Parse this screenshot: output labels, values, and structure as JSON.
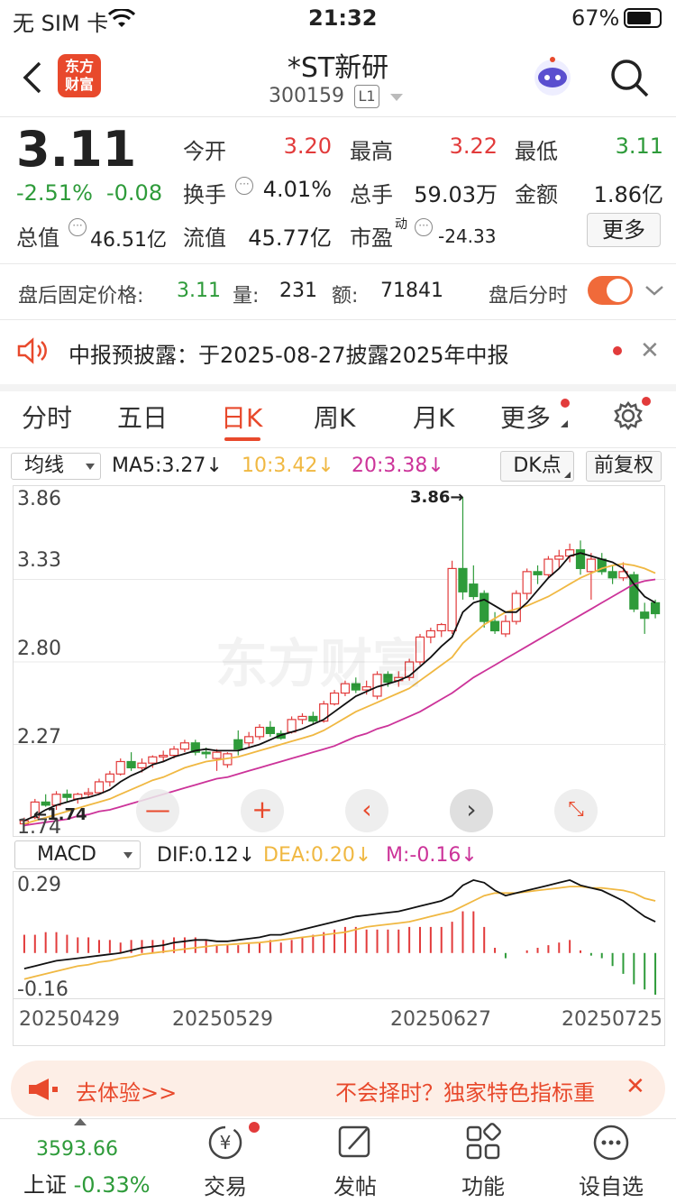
{
  "status": {
    "carrier": "无 SIM 卡",
    "time": "21:32",
    "battery": "67%"
  },
  "header": {
    "logo": "东方\n财富",
    "title": "*ST新研",
    "code": "300159",
    "level": "L1"
  },
  "quote": {
    "price": "3.11",
    "pct": "-2.51%",
    "chg": "-0.08",
    "open_label": "今开",
    "open": "3.20",
    "high_label": "最高",
    "high": "3.22",
    "low_label": "最低",
    "low": "3.11",
    "turnover_label": "换手",
    "turnover": "4.01%",
    "vol_label": "总手",
    "vol": "59.03万",
    "amount_label": "金额",
    "amount": "1.86亿",
    "mktcap_label": "总值",
    "mktcap": "46.51亿",
    "float_label": "流值",
    "float": "45.77亿",
    "pe_label": "市盈",
    "pe_sup": "动",
    "pe": "-24.33",
    "more": "更多"
  },
  "after": {
    "label": "盘后固定价格:",
    "price": "3.11",
    "vol_label": "量:",
    "vol": "231",
    "amt_label": "额:",
    "amt": "71841",
    "toggle_label": "盘后分时"
  },
  "notice": {
    "text": "中报预披露：于2025-08-27披露2025年中报"
  },
  "tabs": [
    "分时",
    "五日",
    "日K",
    "周K",
    "月K",
    "更多"
  ],
  "ma": {
    "type": "均线",
    "ma5": "MA5:3.27",
    "ma10": "10:3.42",
    "ma20": "20:3.38",
    "dk": "DK点",
    "adj": "前复权"
  },
  "kline": {
    "yticks": [
      "3.86",
      "3.33",
      "2.80",
      "2.27",
      "1.74"
    ],
    "max_label": "3.86",
    "min_label": "1.74",
    "watermark": "东方财富"
  },
  "macd": {
    "type": "MACD",
    "dif": "DIF:0.12",
    "dea": "DEA:0.20",
    "m": "M:-0.16",
    "ytop": "0.29",
    "ybot": "-0.16"
  },
  "dates": [
    "20250429",
    "20250529",
    "20250627",
    "20250725"
  ],
  "promo": {
    "left": "去体验>>",
    "right": "不会择时？独家特色指标重"
  },
  "bottom": {
    "index_val": "3593.66",
    "index_name": "上证",
    "index_pct": "-0.33%",
    "trade": "交易",
    "post": "发帖",
    "func": "功能",
    "settings": "设自选"
  },
  "colors": {
    "up": "#e23b3b",
    "down": "#2e9b3a",
    "ma10": "#f0b842",
    "ma20": "#cc3399"
  },
  "chart_data": {
    "type": "candlestick",
    "ylim": [
      1.74,
      3.86
    ],
    "candles": [
      [
        1.76,
        1.8,
        1.74,
        1.78
      ],
      [
        1.8,
        1.92,
        1.79,
        1.9
      ],
      [
        1.9,
        1.95,
        1.87,
        1.88
      ],
      [
        1.88,
        1.97,
        1.85,
        1.95
      ],
      [
        1.95,
        1.98,
        1.9,
        1.93
      ],
      [
        1.92,
        1.96,
        1.89,
        1.95
      ],
      [
        1.95,
        1.99,
        1.93,
        1.96
      ],
      [
        1.96,
        2.05,
        1.95,
        2.03
      ],
      [
        2.03,
        2.1,
        2.0,
        2.08
      ],
      [
        2.08,
        2.18,
        2.07,
        2.16
      ],
      [
        2.16,
        2.22,
        2.1,
        2.12
      ],
      [
        2.12,
        2.18,
        2.09,
        2.15
      ],
      [
        2.15,
        2.2,
        2.12,
        2.19
      ],
      [
        2.19,
        2.23,
        2.16,
        2.2
      ],
      [
        2.2,
        2.26,
        2.18,
        2.24
      ],
      [
        2.24,
        2.3,
        2.22,
        2.28
      ],
      [
        2.28,
        2.3,
        2.2,
        2.22
      ],
      [
        2.22,
        2.25,
        2.18,
        2.21
      ],
      [
        2.18,
        2.24,
        2.1,
        2.22
      ],
      [
        2.14,
        2.22,
        2.12,
        2.21
      ],
      [
        2.3,
        2.36,
        2.2,
        2.24
      ],
      [
        2.28,
        2.35,
        2.25,
        2.32
      ],
      [
        2.32,
        2.4,
        2.3,
        2.38
      ],
      [
        2.38,
        2.42,
        2.32,
        2.34
      ],
      [
        2.34,
        2.36,
        2.3,
        2.31
      ],
      [
        2.35,
        2.45,
        2.34,
        2.43
      ],
      [
        2.43,
        2.47,
        2.4,
        2.45
      ],
      [
        2.45,
        2.48,
        2.4,
        2.42
      ],
      [
        2.42,
        2.55,
        2.41,
        2.53
      ],
      [
        2.53,
        2.62,
        2.52,
        2.6
      ],
      [
        2.6,
        2.68,
        2.58,
        2.66
      ],
      [
        2.66,
        2.7,
        2.6,
        2.62
      ],
      [
        2.62,
        2.68,
        2.59,
        2.64
      ],
      [
        2.58,
        2.74,
        2.56,
        2.72
      ],
      [
        2.72,
        2.74,
        2.64,
        2.67
      ],
      [
        2.68,
        2.74,
        2.64,
        2.7
      ],
      [
        2.7,
        2.82,
        2.68,
        2.8
      ],
      [
        2.8,
        2.98,
        2.78,
        2.96
      ],
      [
        2.96,
        3.02,
        2.92,
        3.0
      ],
      [
        3.0,
        3.05,
        2.96,
        3.04
      ],
      [
        3.0,
        3.45,
        2.98,
        3.4
      ],
      [
        3.4,
        3.86,
        3.2,
        3.25
      ],
      [
        3.3,
        3.42,
        3.2,
        3.22
      ],
      [
        3.24,
        3.26,
        3.02,
        3.06
      ],
      [
        3.06,
        3.12,
        2.98,
        3.0
      ],
      [
        2.98,
        3.1,
        2.96,
        3.06
      ],
      [
        3.06,
        3.26,
        3.04,
        3.24
      ],
      [
        3.24,
        3.4,
        3.2,
        3.38
      ],
      [
        3.38,
        3.42,
        3.3,
        3.36
      ],
      [
        3.36,
        3.48,
        3.34,
        3.46
      ],
      [
        3.46,
        3.52,
        3.4,
        3.48
      ],
      [
        3.48,
        3.56,
        3.44,
        3.52
      ],
      [
        3.52,
        3.58,
        3.36,
        3.4
      ],
      [
        3.38,
        3.5,
        3.2,
        3.46
      ],
      [
        3.46,
        3.5,
        3.36,
        3.38
      ],
      [
        3.38,
        3.42,
        3.3,
        3.34
      ],
      [
        3.34,
        3.44,
        3.32,
        3.38
      ],
      [
        3.36,
        3.38,
        3.12,
        3.14
      ],
      [
        3.12,
        3.18,
        2.98,
        3.08
      ],
      [
        3.18,
        3.2,
        3.08,
        3.11
      ]
    ],
    "ma5": [
      1.78,
      1.81,
      1.85,
      1.88,
      1.9,
      1.92,
      1.93,
      1.95,
      1.98,
      2.03,
      2.07,
      2.1,
      2.14,
      2.16,
      2.19,
      2.21,
      2.23,
      2.24,
      2.23,
      2.23,
      2.23,
      2.25,
      2.27,
      2.3,
      2.33,
      2.35,
      2.37,
      2.4,
      2.43,
      2.48,
      2.53,
      2.58,
      2.61,
      2.64,
      2.66,
      2.68,
      2.71,
      2.77,
      2.83,
      2.9,
      2.96,
      3.12,
      3.18,
      3.2,
      3.16,
      3.12,
      3.12,
      3.18,
      3.26,
      3.34,
      3.4,
      3.48,
      3.5,
      3.48,
      3.46,
      3.44,
      3.4,
      3.3,
      3.22,
      3.18
    ],
    "ma10": [
      1.76,
      1.78,
      1.8,
      1.82,
      1.84,
      1.86,
      1.88,
      1.9,
      1.92,
      1.95,
      1.98,
      2.01,
      2.04,
      2.06,
      2.09,
      2.12,
      2.14,
      2.16,
      2.17,
      2.18,
      2.19,
      2.21,
      2.23,
      2.25,
      2.27,
      2.29,
      2.31,
      2.33,
      2.36,
      2.4,
      2.44,
      2.48,
      2.51,
      2.54,
      2.57,
      2.6,
      2.63,
      2.68,
      2.73,
      2.78,
      2.83,
      2.92,
      2.98,
      3.04,
      3.08,
      3.12,
      3.14,
      3.16,
      3.19,
      3.22,
      3.26,
      3.3,
      3.34,
      3.37,
      3.4,
      3.42,
      3.43,
      3.42,
      3.4,
      3.37
    ],
    "ma20": [
      1.75,
      1.76,
      1.77,
      1.78,
      1.79,
      1.81,
      1.82,
      1.84,
      1.85,
      1.87,
      1.89,
      1.91,
      1.93,
      1.95,
      1.97,
      1.99,
      2.01,
      2.03,
      2.05,
      2.06,
      2.08,
      2.1,
      2.12,
      2.14,
      2.16,
      2.18,
      2.2,
      2.22,
      2.24,
      2.26,
      2.29,
      2.32,
      2.34,
      2.37,
      2.39,
      2.42,
      2.45,
      2.48,
      2.52,
      2.56,
      2.6,
      2.65,
      2.7,
      2.74,
      2.78,
      2.82,
      2.86,
      2.9,
      2.94,
      2.98,
      3.02,
      3.06,
      3.1,
      3.14,
      3.18,
      3.22,
      3.26,
      3.3,
      3.32,
      3.33
    ],
    "macd": {
      "ylim": [
        -0.16,
        0.29
      ],
      "dif": [
        -0.06,
        -0.05,
        -0.04,
        -0.03,
        -0.025,
        -0.02,
        -0.015,
        -0.01,
        -0.005,
        0.0,
        0.01,
        0.02,
        0.025,
        0.03,
        0.04,
        0.045,
        0.05,
        0.05,
        0.045,
        0.045,
        0.05,
        0.055,
        0.06,
        0.07,
        0.07,
        0.08,
        0.09,
        0.1,
        0.11,
        0.12,
        0.13,
        0.14,
        0.145,
        0.15,
        0.155,
        0.16,
        0.17,
        0.18,
        0.19,
        0.2,
        0.22,
        0.26,
        0.28,
        0.27,
        0.24,
        0.22,
        0.23,
        0.24,
        0.25,
        0.26,
        0.27,
        0.28,
        0.26,
        0.25,
        0.24,
        0.22,
        0.2,
        0.17,
        0.14,
        0.12
      ],
      "dea": [
        -0.1,
        -0.09,
        -0.08,
        -0.07,
        -0.06,
        -0.05,
        -0.045,
        -0.035,
        -0.03,
        -0.02,
        -0.015,
        -0.005,
        0.0,
        0.005,
        0.01,
        0.015,
        0.02,
        0.025,
        0.03,
        0.032,
        0.035,
        0.038,
        0.04,
        0.045,
        0.05,
        0.055,
        0.06,
        0.065,
        0.07,
        0.075,
        0.08,
        0.09,
        0.1,
        0.105,
        0.11,
        0.115,
        0.12,
        0.13,
        0.14,
        0.15,
        0.16,
        0.18,
        0.2,
        0.22,
        0.23,
        0.23,
        0.23,
        0.235,
        0.24,
        0.245,
        0.25,
        0.255,
        0.255,
        0.25,
        0.25,
        0.245,
        0.24,
        0.23,
        0.21,
        0.2
      ],
      "m": [
        0.07,
        0.07,
        0.08,
        0.08,
        0.07,
        0.06,
        0.06,
        0.05,
        0.05,
        0.04,
        0.05,
        0.05,
        0.05,
        0.05,
        0.06,
        0.06,
        0.06,
        0.05,
        0.03,
        0.03,
        0.03,
        0.035,
        0.04,
        0.05,
        0.04,
        0.05,
        0.06,
        0.07,
        0.08,
        0.09,
        0.1,
        0.1,
        0.09,
        0.09,
        0.09,
        0.09,
        0.1,
        0.1,
        0.1,
        0.1,
        0.12,
        0.16,
        0.16,
        0.1,
        0.02,
        -0.02,
        0.0,
        0.01,
        0.02,
        0.03,
        0.04,
        0.05,
        0.01,
        -0.01,
        -0.02,
        -0.05,
        -0.08,
        -0.12,
        -0.14,
        -0.16
      ]
    }
  }
}
